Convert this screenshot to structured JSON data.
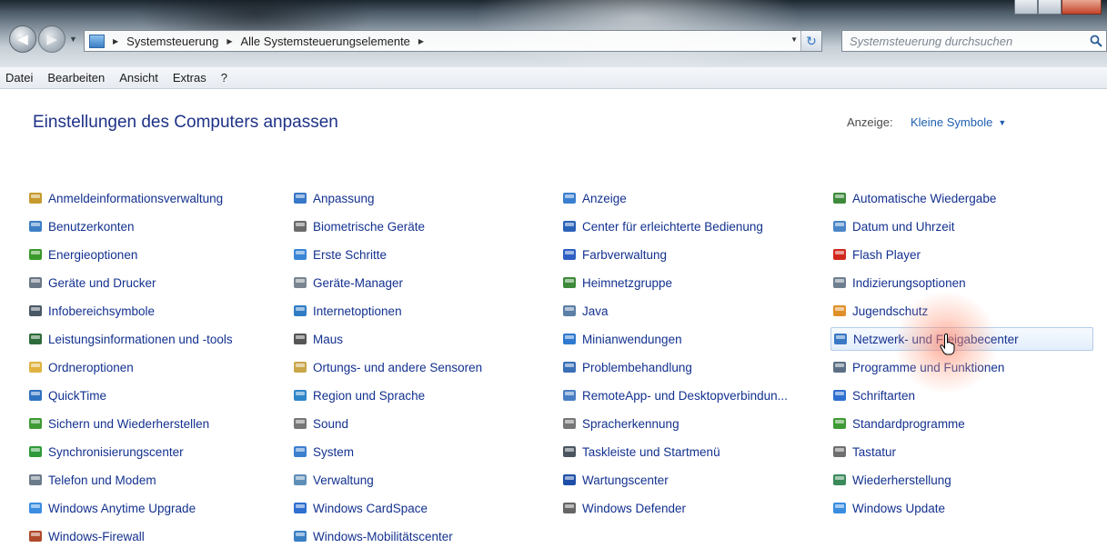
{
  "address_bar": {
    "breadcrumbs": [
      "Systemsteuerung",
      "Alle Systemsteuerungselemente"
    ],
    "search_placeholder": "Systemsteuerung durchsuchen"
  },
  "menu": [
    "Datei",
    "Bearbeiten",
    "Ansicht",
    "Extras",
    "?"
  ],
  "page_title": "Einstellungen des Computers anpassen",
  "view": {
    "label": "Anzeige:",
    "selected": "Kleine Symbole"
  },
  "columns": [
    [
      {
        "label": "Anmeldeinformationsverwaltung",
        "icon": "credential-icon",
        "color": "#c79a2e"
      },
      {
        "label": "Benutzerkonten",
        "icon": "users-icon",
        "color": "#3d7fc6"
      },
      {
        "label": "Energieoptionen",
        "icon": "power-icon",
        "color": "#3a9a2c"
      },
      {
        "label": "Geräte und Drucker",
        "icon": "printer-icon",
        "color": "#6b7886"
      },
      {
        "label": "Infobereichsymbole",
        "icon": "taskbar-icon",
        "color": "#4a5866"
      },
      {
        "label": "Leistungsinformationen und -tools",
        "icon": "performance-icon",
        "color": "#2e6b3a"
      },
      {
        "label": "Ordneroptionen",
        "icon": "folder-icon",
        "color": "#e0b340"
      },
      {
        "label": "QuickTime",
        "icon": "quicktime-icon",
        "color": "#2f72c0"
      },
      {
        "label": "Sichern und Wiederherstellen",
        "icon": "backup-icon",
        "color": "#3f9a35"
      },
      {
        "label": "Synchronisierungscenter",
        "icon": "sync-icon",
        "color": "#2f9a3c"
      },
      {
        "label": "Telefon und Modem",
        "icon": "phone-icon",
        "color": "#6c7b8a"
      },
      {
        "label": "Windows Anytime Upgrade",
        "icon": "windows-flag-icon",
        "color": "#3a8de0"
      },
      {
        "label": "Windows-Firewall",
        "icon": "firewall-icon",
        "color": "#b04a2a"
      }
    ],
    [
      {
        "label": "Anpassung",
        "icon": "personalization-icon",
        "color": "#3878c8"
      },
      {
        "label": "Biometrische Geräte",
        "icon": "fingerprint-icon",
        "color": "#6b6b6b"
      },
      {
        "label": "Erste Schritte",
        "icon": "getting-started-icon",
        "color": "#3a85d6"
      },
      {
        "label": "Geräte-Manager",
        "icon": "device-manager-icon",
        "color": "#7a8591"
      },
      {
        "label": "Internetoptionen",
        "icon": "internet-options-icon",
        "color": "#2f7cc4"
      },
      {
        "label": "Maus",
        "icon": "mouse-icon",
        "color": "#555555"
      },
      {
        "label": "Ortungs- und andere Sensoren",
        "icon": "sensor-icon",
        "color": "#c9a64a"
      },
      {
        "label": "Region und Sprache",
        "icon": "globe-icon",
        "color": "#2f86c8"
      },
      {
        "label": "Sound",
        "icon": "speaker-icon",
        "color": "#777777"
      },
      {
        "label": "System",
        "icon": "system-icon",
        "color": "#3c7fcf"
      },
      {
        "label": "Verwaltung",
        "icon": "admin-tools-icon",
        "color": "#5f8fb8"
      },
      {
        "label": "Windows CardSpace",
        "icon": "cardspace-icon",
        "color": "#2f6fd0"
      },
      {
        "label": "Windows-Mobilitätscenter",
        "icon": "mobility-icon",
        "color": "#3a7fc4"
      }
    ],
    [
      {
        "label": "Anzeige",
        "icon": "display-icon",
        "color": "#3a7fd0"
      },
      {
        "label": "Center für erleichterte Bedienung",
        "icon": "ease-of-access-icon",
        "color": "#2a62b8"
      },
      {
        "label": "Farbverwaltung",
        "icon": "color-management-icon",
        "color": "#2e5ec4"
      },
      {
        "label": "Heimnetzgruppe",
        "icon": "homegroup-icon",
        "color": "#3c8a3a"
      },
      {
        "label": "Java",
        "icon": "java-icon",
        "color": "#5b7fa6"
      },
      {
        "label": "Minianwendungen",
        "icon": "gadgets-icon",
        "color": "#2f7ad0"
      },
      {
        "label": "Problembehandlung",
        "icon": "troubleshooting-icon",
        "color": "#3a6fb8"
      },
      {
        "label": "RemoteApp- und Desktopverbindun...",
        "icon": "remoteapp-icon",
        "color": "#4a7fc4"
      },
      {
        "label": "Spracherkennung",
        "icon": "microphone-icon",
        "color": "#777777"
      },
      {
        "label": "Taskleiste und Startmenü",
        "icon": "taskbar-start-icon",
        "color": "#4b5560"
      },
      {
        "label": "Wartungscenter",
        "icon": "action-center-flag-icon",
        "color": "#1e4fa8"
      },
      {
        "label": "Windows Defender",
        "icon": "defender-icon",
        "color": "#666666"
      }
    ],
    [
      {
        "label": "Automatische Wiedergabe",
        "icon": "autoplay-icon",
        "color": "#3d8b3a"
      },
      {
        "label": "Datum und Uhrzeit",
        "icon": "clock-icon",
        "color": "#4a86c8"
      },
      {
        "label": "Flash Player",
        "icon": "flash-icon",
        "color": "#d0281e"
      },
      {
        "label": "Indizierungsoptionen",
        "icon": "indexing-icon",
        "color": "#6e7f90"
      },
      {
        "label": "Jugendschutz",
        "icon": "parental-controls-icon",
        "color": "#e0902a"
      },
      {
        "label": "Netzwerk- und Freigabecenter",
        "icon": "network-icon",
        "color": "#3a78c4"
      },
      {
        "label": "Programme und Funktionen",
        "icon": "programs-icon",
        "color": "#5c6f84"
      },
      {
        "label": "Schriftarten",
        "icon": "fonts-icon",
        "color": "#2f6fd0"
      },
      {
        "label": "Standardprogramme",
        "icon": "default-programs-icon",
        "color": "#3f9a35"
      },
      {
        "label": "Tastatur",
        "icon": "keyboard-icon",
        "color": "#6f6f6f"
      },
      {
        "label": "Wiederherstellung",
        "icon": "recovery-icon",
        "color": "#3a8a5a"
      },
      {
        "label": "Windows Update",
        "icon": "windows-update-icon",
        "color": "#3a8de0"
      }
    ]
  ],
  "hovered_item": "Netzwerk- und Freigabecenter"
}
